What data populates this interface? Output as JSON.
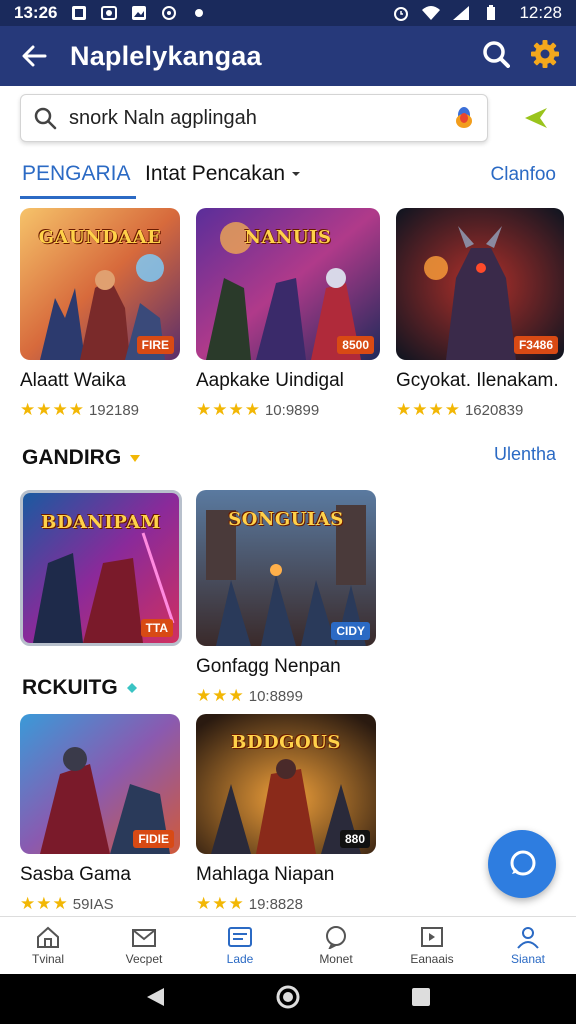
{
  "status_bar": {
    "time_left": "13:26",
    "time_right": "12:28"
  },
  "app_bar": {
    "title": "Naplelykangaa"
  },
  "search": {
    "value": "snork Naln agplingah"
  },
  "tabs": {
    "active": "PENGARIA",
    "dropdown": "Intat Pencakan",
    "link": "Clanfoo"
  },
  "top_row": [
    {
      "name": "Alaatt Waika",
      "rating_text": "192189",
      "stars": 4,
      "banner": "GAUNDAAE",
      "tag": "FIRE"
    },
    {
      "name": "Aapkake Uindigal",
      "rating_text": "10:9899",
      "stars": 4,
      "banner": "NANUIS",
      "tag": "8500"
    },
    {
      "name": "Gcyokat. Ilenakam.",
      "rating_text": "1620839",
      "stars": 4,
      "banner": "",
      "tag": "F3486"
    }
  ],
  "section_gandirg": {
    "title": "GANDIRG",
    "link": "Ulentha"
  },
  "mid_row": [
    {
      "name": "",
      "rating_text": "",
      "banner": "BDANIPAM",
      "tag": "TTA"
    },
    {
      "name": "Gonfagg Nenpan",
      "rating_text": "10:8899",
      "stars": 3,
      "banner": "SONGUIAS",
      "tag": "CIDY"
    }
  ],
  "section_rckuitg": {
    "title": "RCKUITG"
  },
  "bottom_row": [
    {
      "name": "Sasba Gama",
      "rating_text": "59IAS",
      "stars": 3,
      "banner": "",
      "tag": "FIDIE"
    },
    {
      "name": "Mahlaga Niapan",
      "rating_text": "19:8828",
      "stars": 3,
      "banner": "BDDGOUS",
      "tag": "880"
    }
  ],
  "bottom_nav": [
    {
      "label": "Tvinal",
      "icon": "home-icon"
    },
    {
      "label": "Vecpet",
      "icon": "mail-icon"
    },
    {
      "label": "Lade",
      "icon": "tablet-icon"
    },
    {
      "label": "Monet",
      "icon": "chat-icon"
    },
    {
      "label": "Eanaais",
      "icon": "media-icon"
    },
    {
      "label": "Sianat",
      "icon": "profile-icon"
    }
  ],
  "colors": {
    "app_bar": "#26397a",
    "status_bar": "#1a2a5c",
    "accent": "#2b6ac4",
    "star": "#f2b705",
    "fab": "#2e7de0"
  }
}
